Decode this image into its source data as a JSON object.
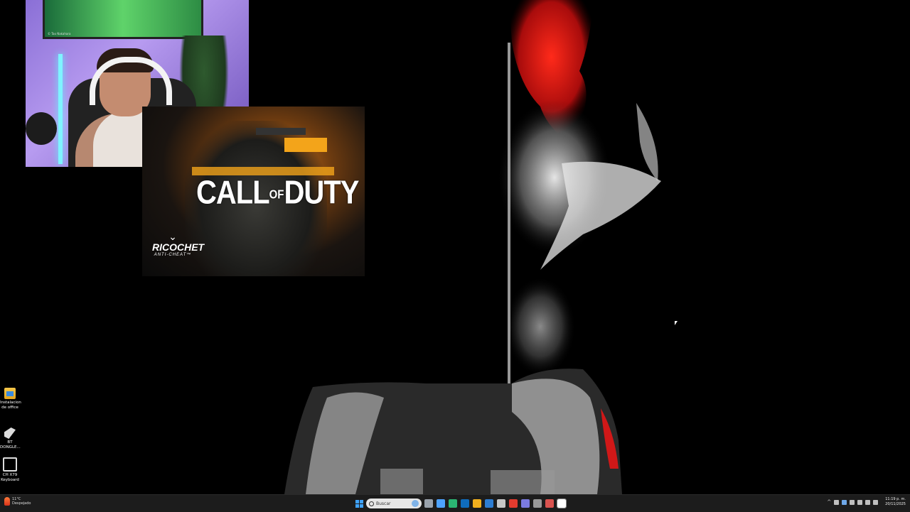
{
  "webcam": {
    "tv_caption": "© Tao Nakahara"
  },
  "splash": {
    "title_call": "CALL",
    "title_of": "OF",
    "title_duty": "DUTY",
    "anticheat_name": "RICOCHET",
    "anticheat_sub": "ANTI-CHEAT™"
  },
  "desktop_icons": [
    {
      "label": "Instalacion de office",
      "icon": "folder-icon"
    },
    {
      "label": "BT DONGLE...",
      "icon": "usb-dongle-icon"
    },
    {
      "label": "CH X79 Keyboard",
      "icon": "keyboard-icon"
    }
  ],
  "taskbar": {
    "weather": {
      "temp": "11°C",
      "condition": "Despejado"
    },
    "search_placeholder": "Buscar",
    "pinned_colors": [
      "#9aa3ad",
      "#4da3ff",
      "#2bb673",
      "#0f6cbd",
      "#f2b01e",
      "#2d7dd2",
      "#c7c7c7",
      "#e23b2e",
      "#7a7ae0",
      "#999999",
      "#d9534f",
      "#e0e0e0"
    ],
    "clock": {
      "time": "11:19 p. m.",
      "date": "20/11/2025"
    }
  }
}
